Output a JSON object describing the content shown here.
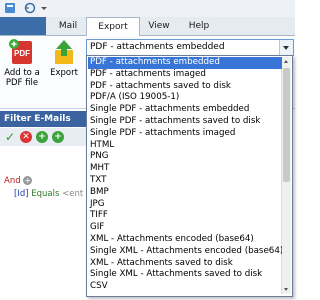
{
  "tabs": [
    "",
    "Mail",
    "Export",
    "View",
    "Help"
  ],
  "ribbon": {
    "add_pdf_label": "Add to a PDF file",
    "export_label": "Export",
    "selected_format": "PDF - attachments embedded"
  },
  "filter": {
    "title": "Filter E-Mails",
    "and_label": "And",
    "condition_field": "[Id]",
    "condition_op": "Equals",
    "condition_value": "<ent"
  },
  "dropdown_options": [
    "PDF - attachments embedded",
    "PDF - attachments imaged",
    "PDF - attachments saved to disk",
    "PDF/A (ISO 19005-1)",
    "Single PDF - attachments embedded",
    "Single PDF - attachments saved to disk",
    "Single PDF - attachments imaged",
    "HTML",
    "PNG",
    "MHT",
    "TXT",
    "BMP",
    "JPG",
    "TIFF",
    "GIF",
    "XML - Attachments encoded (base64)",
    "Single XML - Attachments encoded (base64)",
    "XML - Attachments saved to disk",
    "Single XML - Attachments saved to disk",
    "CSV"
  ],
  "selected_index": 0,
  "colors": {
    "selection": "#3875d7",
    "filter_header": "#3a63a0",
    "and_text": "#c21a1a"
  }
}
